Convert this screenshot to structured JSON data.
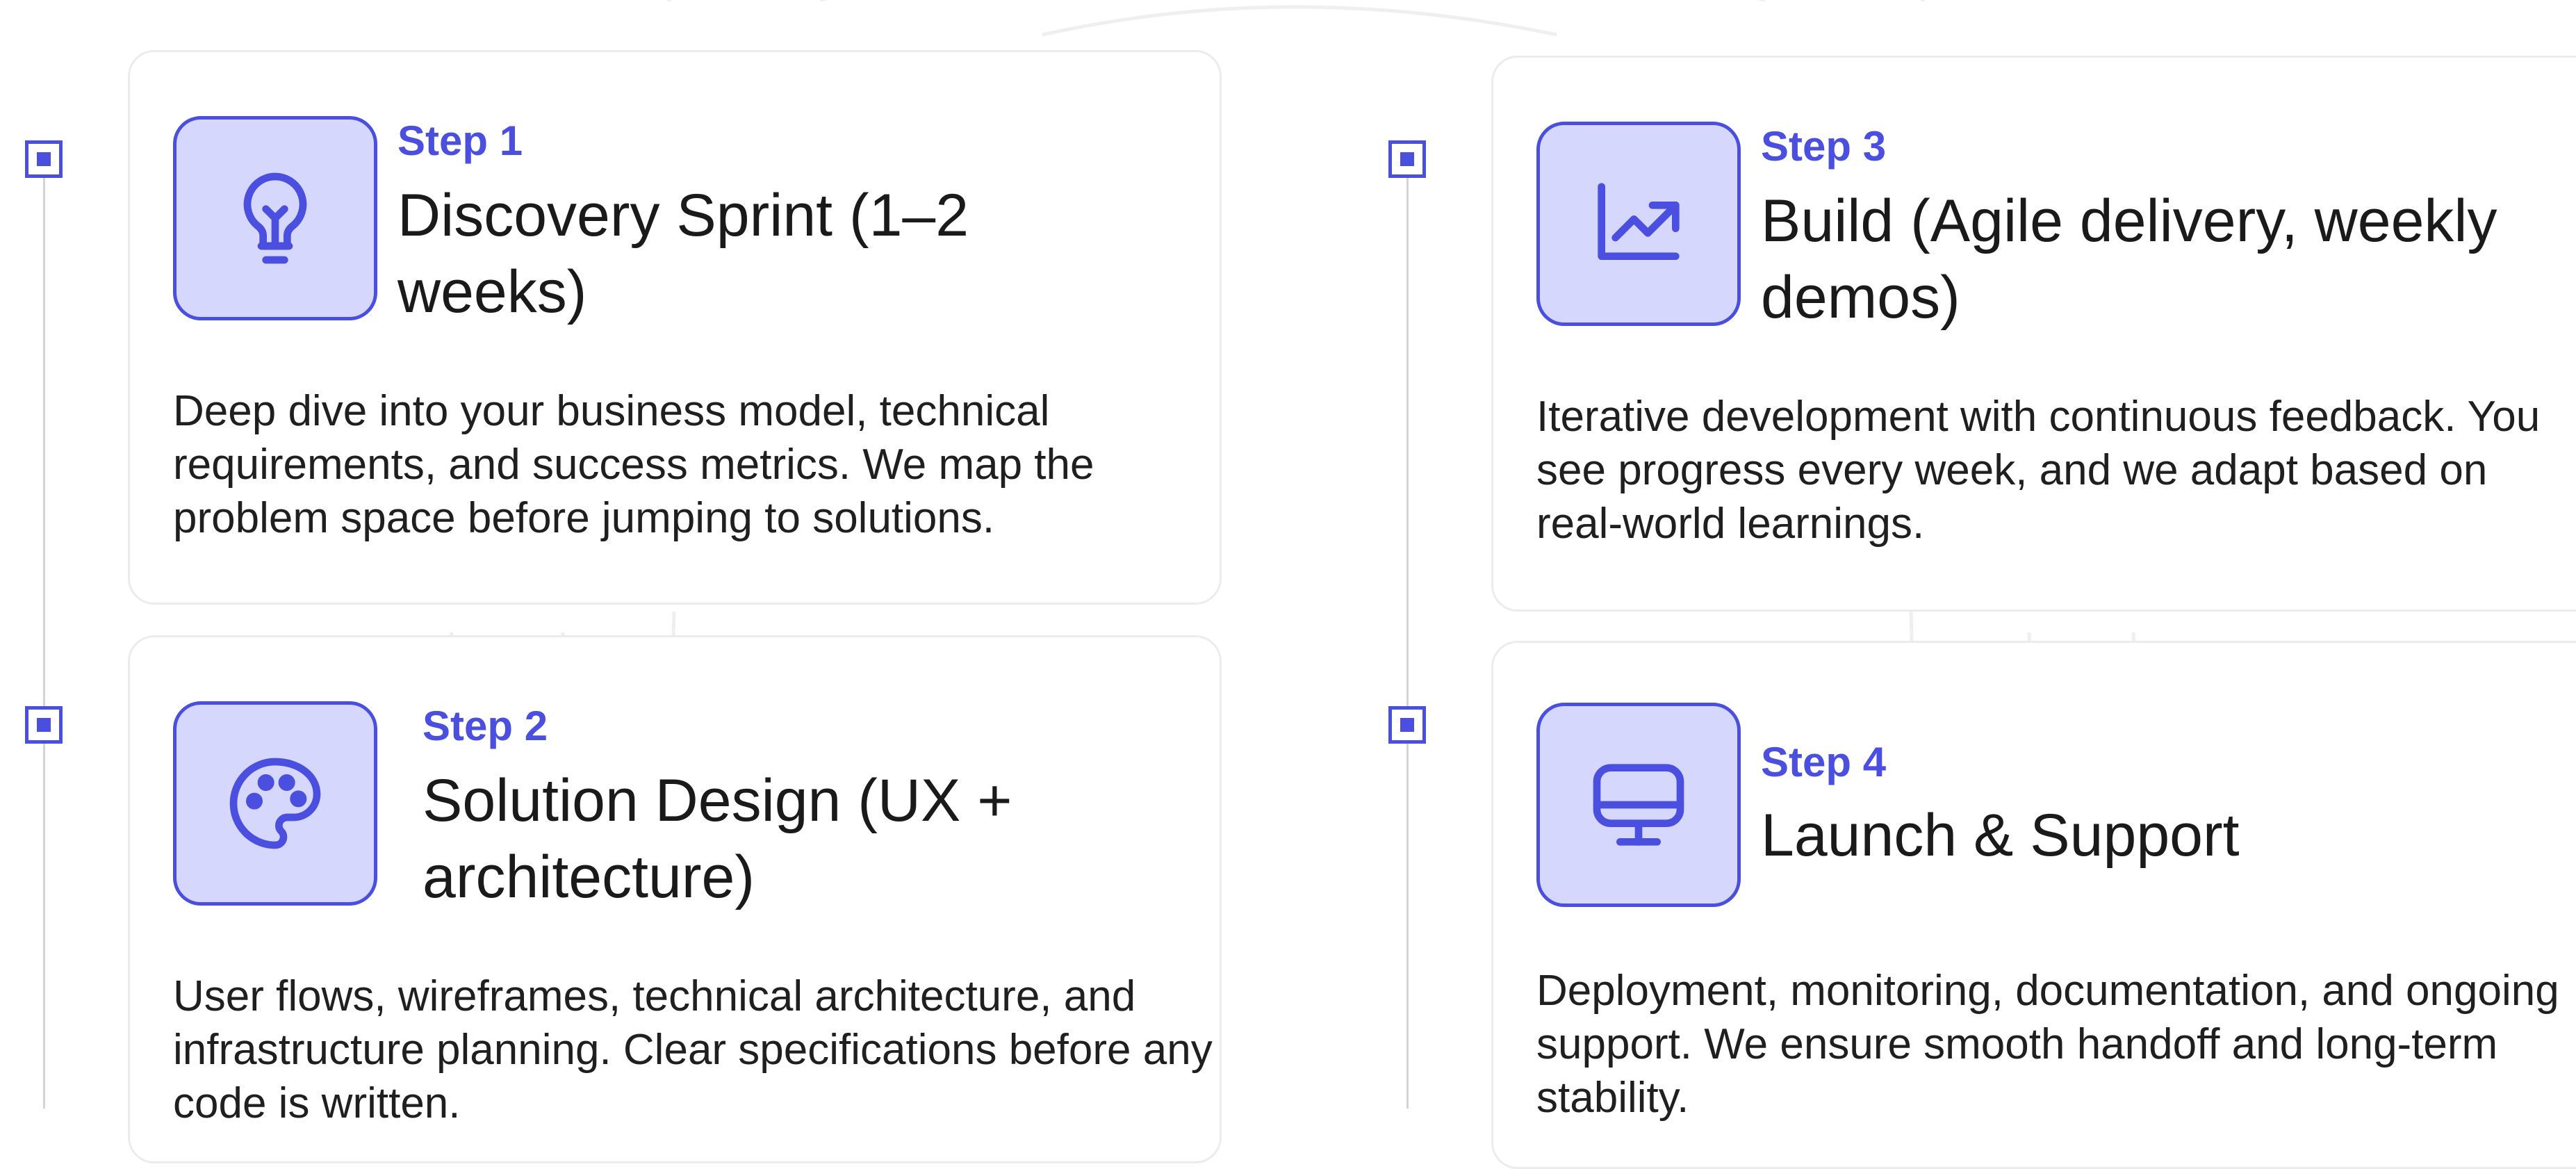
{
  "steps": [
    {
      "label": "Step 1",
      "title": "Discovery Sprint (1–2 weeks)",
      "description": "Deep dive into your business model, technical requirements, and success metrics. We map the problem space before jumping to solutions.",
      "icon": "lightbulb-icon"
    },
    {
      "label": "Step 2",
      "title": "Solution Design (UX + architecture)",
      "description": "User flows, wireframes, technical architecture, and infrastructure planning. Clear specifications before any code is written.",
      "icon": "palette-icon"
    },
    {
      "label": "Step 3",
      "title": "Build (Agile delivery, weekly demos)",
      "description": "Iterative development with continuous feedback. You see progress every week, and we adapt based on real-world learnings.",
      "icon": "trending-chart-icon"
    },
    {
      "label": "Step 4",
      "title": "Launch & Support",
      "description": "Deployment, monitoring, documentation, and ongoing support. We ensure smooth handoff and long-term stability.",
      "icon": "monitor-icon"
    }
  ],
  "colors": {
    "accent": "#4a4fe0",
    "icon_background": "#d6d7fd",
    "card_border": "#ececec",
    "text": "#1a1a1a"
  }
}
